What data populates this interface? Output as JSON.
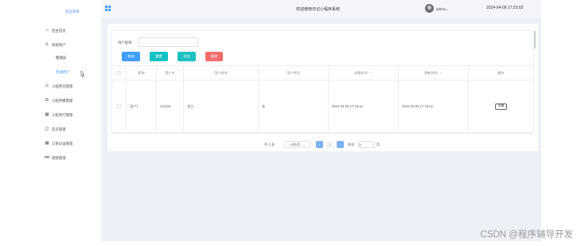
{
  "sidebar": {
    "logo_text": "后台系统",
    "items": [
      {
        "label": "后台首页",
        "icon": "home-icon"
      },
      {
        "label": "系统用户",
        "icon": "user-icon"
      },
      {
        "label": "小程序页管理",
        "icon": "circle-icon"
      },
      {
        "label": "小程序模管理",
        "icon": "gear-icon"
      },
      {
        "label": "小程序行管理",
        "icon": "grid-icon"
      },
      {
        "label": "实名管理",
        "icon": "bag-icon"
      },
      {
        "label": "订单记录管理",
        "icon": "grid-icon"
      },
      {
        "label": "权限管理",
        "icon": "share-icon"
      }
    ],
    "submenu": [
      {
        "label": "管理员",
        "active": false
      },
      {
        "label": "普通用户",
        "active": true
      }
    ]
  },
  "header": {
    "title": "欢迎使用日记小程序系统",
    "user": "admin",
    "datetime": "2024-04-09 17:23:03"
  },
  "search": {
    "label": "用户昵称",
    "value": "",
    "placeholder": ""
  },
  "toolbar": {
    "search_label": "查询",
    "reset_label": "重置",
    "add_label": "添加",
    "delete_label": "删除"
  },
  "table": {
    "columns": [
      "昵称",
      "用户名",
      "用户姓名",
      "用户性别",
      "创建时间",
      "更新时间",
      "操作"
    ],
    "rows": [
      {
        "nickname": "用户1",
        "username": "112233",
        "realname": "张三",
        "gender": "女",
        "created": "2024-04-09 17:19:42",
        "updated": "2024-04-09 17:19:42",
        "action": "详情"
      }
    ]
  },
  "pagination": {
    "total": "共 1 条",
    "page_size": "10条/页",
    "current_page": "1",
    "goto_label": "前往",
    "jump_value": "1",
    "page_suffix": "页"
  },
  "watermark": "CSDN @程序辅导开发",
  "colors": {
    "primary": "#409eff",
    "teal": "#13c2c2",
    "danger": "#f56c6c",
    "main_bg": "#edf0f6"
  }
}
